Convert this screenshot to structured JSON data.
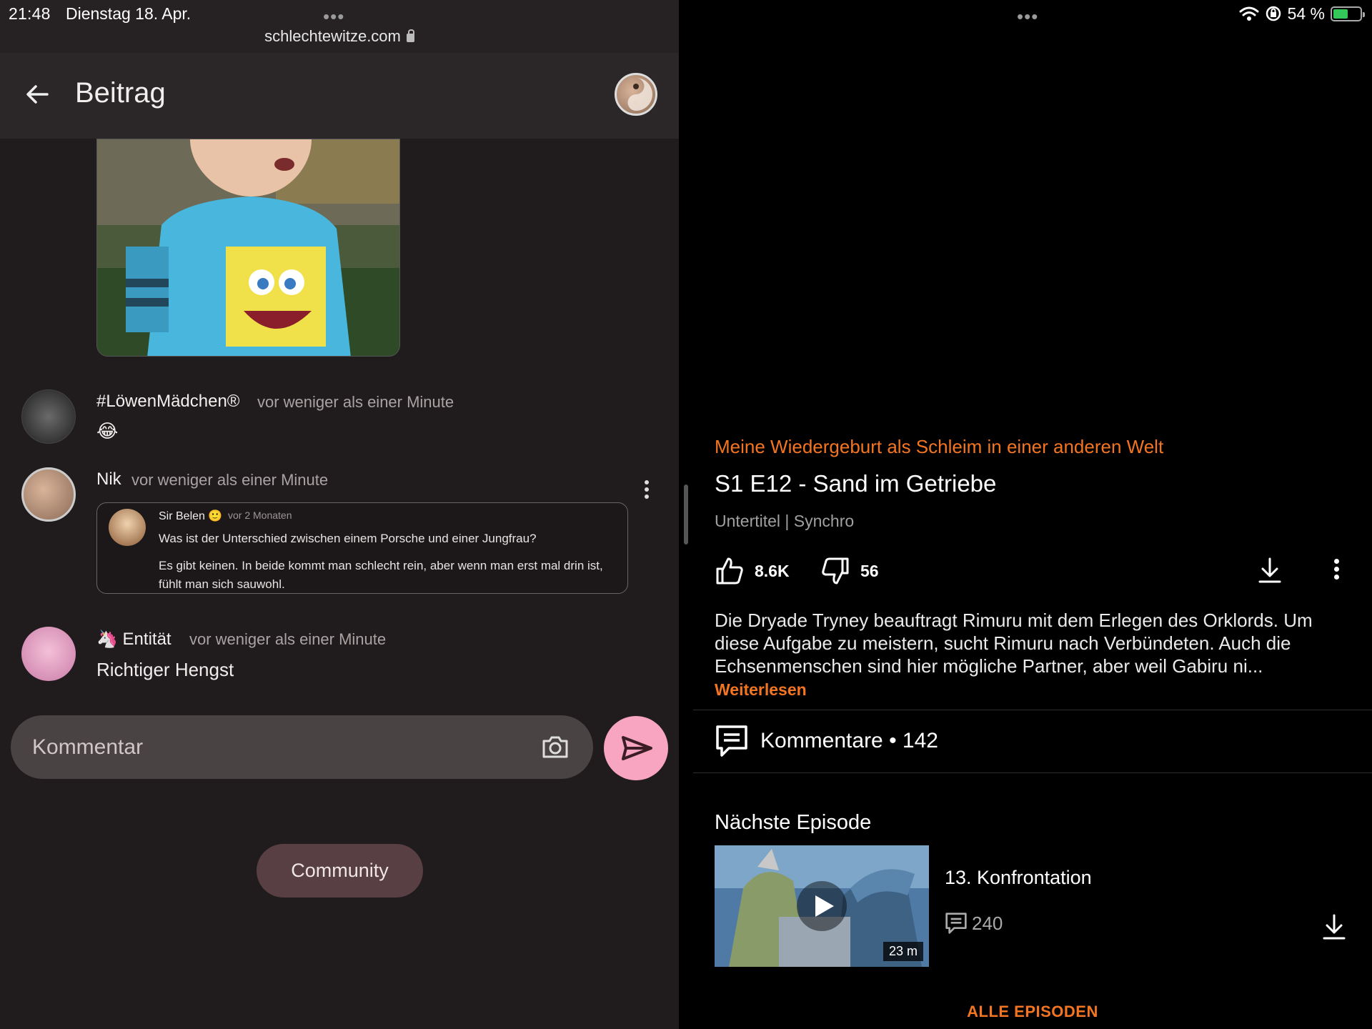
{
  "left": {
    "status": {
      "time": "21:48",
      "date": "Dienstag 18. Apr.",
      "dots": "•••",
      "url": "schlechtewitze.com"
    },
    "appbar": {
      "title": "Beitrag"
    },
    "comments": [
      {
        "name": "#LöwenMädchen®",
        "time": "vor weniger als einer Minute",
        "text": "😂"
      },
      {
        "name": "Nik",
        "time": "vor weniger als einer Minute",
        "quote": {
          "name": "Sir Belen 🙂",
          "time": "vor 2 Monaten",
          "line1": "Was ist der Unterschied zwischen einem Porsche und einer Jungfrau?",
          "line2": "Es gibt keinen. In beide kommt man schlecht rein, aber wenn man erst mal drin ist, fühlt man sich sauwohl."
        }
      },
      {
        "name": "🦄 Entität",
        "time": "vor weniger als einer Minute",
        "text": "Richtiger Hengst"
      }
    ],
    "input": {
      "placeholder": "Kommentar"
    },
    "community_label": "Community"
  },
  "right": {
    "status": {
      "dots": "•••",
      "battery": "54 %"
    },
    "show_title": "Meine Wiedergeburt als Schleim in einer anderen Welt",
    "episode_title": "S1 E12 - Sand im Getriebe",
    "meta": "Untertitel | Synchro",
    "likes": "8.6K",
    "dislikes": "56",
    "description": "Die Dryade Tryney beauftragt Rimuru mit dem Erlegen des Orklords. Um diese Aufgabe zu meistern, sucht Rimuru nach Verbündeten. Auch die Echsenmenschen sind hier mögliche Partner, aber weil Gabiru ni...",
    "read_more": "Weiterlesen",
    "comments_label": "Kommentare • 142",
    "next": {
      "label": "Nächste Episode",
      "title": "13. Konfrontation",
      "comments": "240",
      "duration": "23 m"
    },
    "all_episodes": "ALLE EPISODEN"
  }
}
